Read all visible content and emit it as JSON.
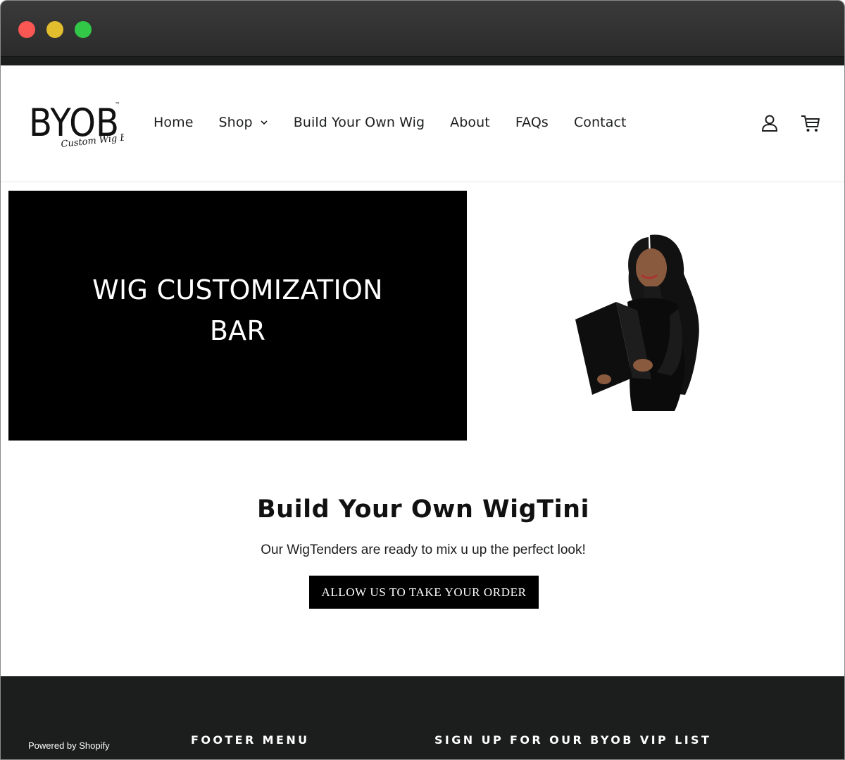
{
  "brand": {
    "logo_text": "BYOB",
    "logo_tagline": "Custom Wig Bar",
    "logo_tm": "™"
  },
  "nav": {
    "items": [
      {
        "label": "Home"
      },
      {
        "label": "Shop"
      },
      {
        "label": "Build Your Own Wig"
      },
      {
        "label": "About"
      },
      {
        "label": "FAQs"
      },
      {
        "label": "Contact"
      }
    ]
  },
  "header_icons": [
    "account-icon",
    "cart-icon"
  ],
  "hero": {
    "title_line1": "WIG CUSTOMIZATION",
    "title_line2": "BAR"
  },
  "cta": {
    "heading": "Build Your Own WigTini",
    "subtext": "Our WigTenders are ready to mix u up the perfect look!",
    "button_label": "ALLOW US TO TAKE YOUR ORDER"
  },
  "footer": {
    "powered_by": "Powered by Shopify",
    "menu_heading": "FOOTER MENU",
    "vip_heading": "SIGN UP FOR OUR BYOB VIP LIST"
  },
  "colors": {
    "footer_bg": "#1c1d1d",
    "hero_bg": "#000000",
    "button_bg": "#000000",
    "traffic_close": "#fc5753",
    "traffic_min": "#e2bd2d",
    "traffic_max": "#33c748"
  }
}
